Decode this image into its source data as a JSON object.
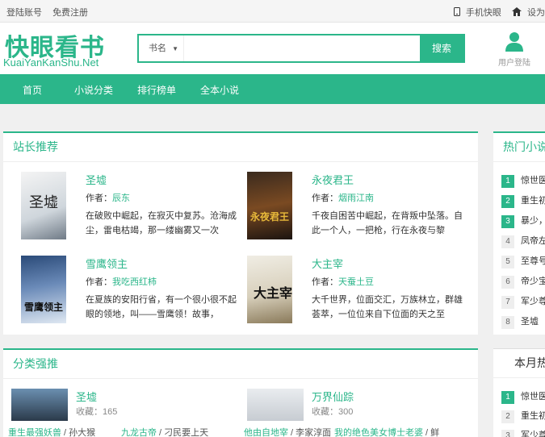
{
  "top_bar": {
    "login": "登陆账号",
    "register": "免费注册",
    "mobile": "手机快眼",
    "settings": "设为"
  },
  "header": {
    "logo_cn": "快眼看书",
    "logo_en": "KuaiYanKanShu.Net",
    "search_type": "书名",
    "search_placeholder": "",
    "search_button": "搜索",
    "user_label": "用户登陆"
  },
  "nav": [
    "首页",
    "小说分类",
    "排行榜单",
    "全本小说"
  ],
  "recommend": {
    "title": "站长推荐",
    "books": [
      {
        "title": "圣墟",
        "author_label": "作者：",
        "author": "辰东",
        "desc": "在破败中崛起，在寂灭中复苏。沧海成尘，雷电枯竭，那一缕幽雾又一次"
      },
      {
        "title": "永夜君王",
        "author_label": "作者：",
        "author": "烟雨江南",
        "desc": "千夜自困苦中崛起，在背叛中坠落。自此一个人，一把枪，行在永夜与黎"
      },
      {
        "title": "雪鹰领主",
        "author_label": "作者：",
        "author": "我吃西红柿",
        "desc": "在夏族的安阳行省，有一个很小很不起眼的领地，叫——雪鹰领！故事，"
      },
      {
        "title": "大主宰",
        "author_label": "作者：",
        "author": "天蚕土豆",
        "desc": "大千世界，位面交汇，万族林立，群雄荟萃，一位位来自下位面的天之至"
      }
    ]
  },
  "category": {
    "title": "分类强推",
    "books": [
      {
        "title": "圣墟",
        "meta": "收藏：",
        "count": "165"
      },
      {
        "title": "万界仙踪",
        "meta": "收藏：",
        "count": "300"
      }
    ],
    "links": [
      {
        "a": "重生最强妖兽",
        "b": "孙大猴"
      },
      {
        "a": "九龙古帝",
        "b": "刁民要上天"
      },
      {
        "a": "他由自地宰",
        "b": "李家淳面"
      },
      {
        "a": "我的绝色美女博士老婆",
        "b": "鲜"
      }
    ]
  },
  "hot": {
    "title": "热门小说",
    "items": [
      "惊世医",
      "重生初",
      "暴少，",
      "凤帝左",
      "至尊号",
      "帝少宝",
      "军少尊",
      "圣墟"
    ]
  },
  "monthly": {
    "title": "本月热",
    "items": [
      "惊世医",
      "重生初",
      "军少尊"
    ]
  },
  "colors": {
    "accent": "#2bb68a"
  }
}
